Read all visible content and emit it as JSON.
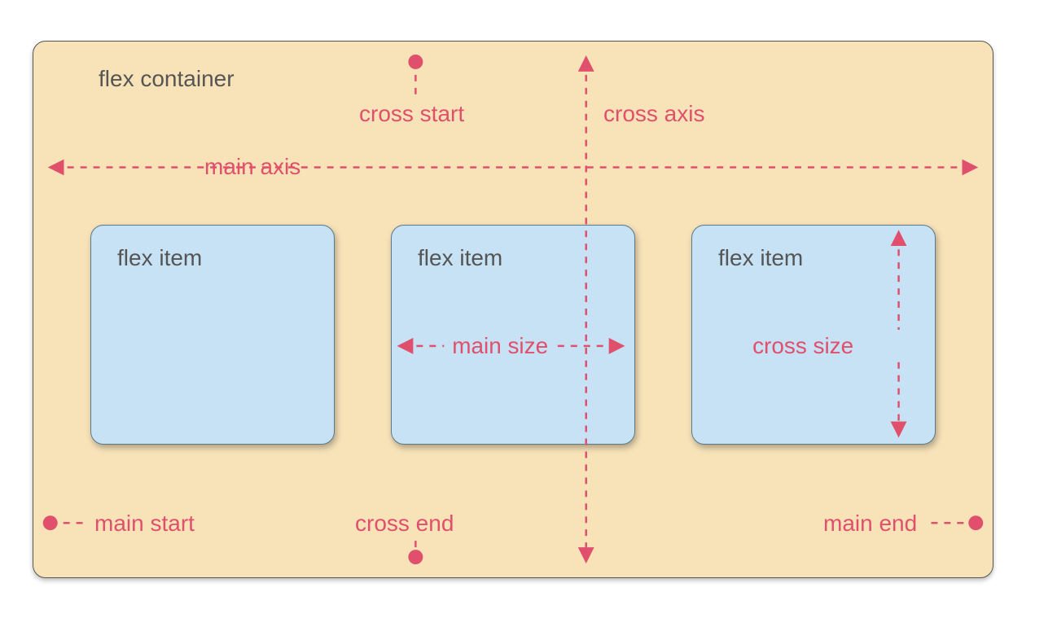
{
  "container": {
    "label": "flex container"
  },
  "items": [
    {
      "label": "flex item"
    },
    {
      "label": "flex item"
    },
    {
      "label": "flex item"
    }
  ],
  "axis_labels": {
    "cross_start": "cross start",
    "cross_axis": "cross axis",
    "main_axis": "main axis",
    "main_size": "main size",
    "cross_size": "cross size",
    "main_start": "main start",
    "cross_end": "cross end",
    "main_end": "main end"
  },
  "colors": {
    "container_bg": "#f8e3b9",
    "item_bg": "#c6e2f4",
    "accent": "#e0506d",
    "text": "#555555"
  }
}
